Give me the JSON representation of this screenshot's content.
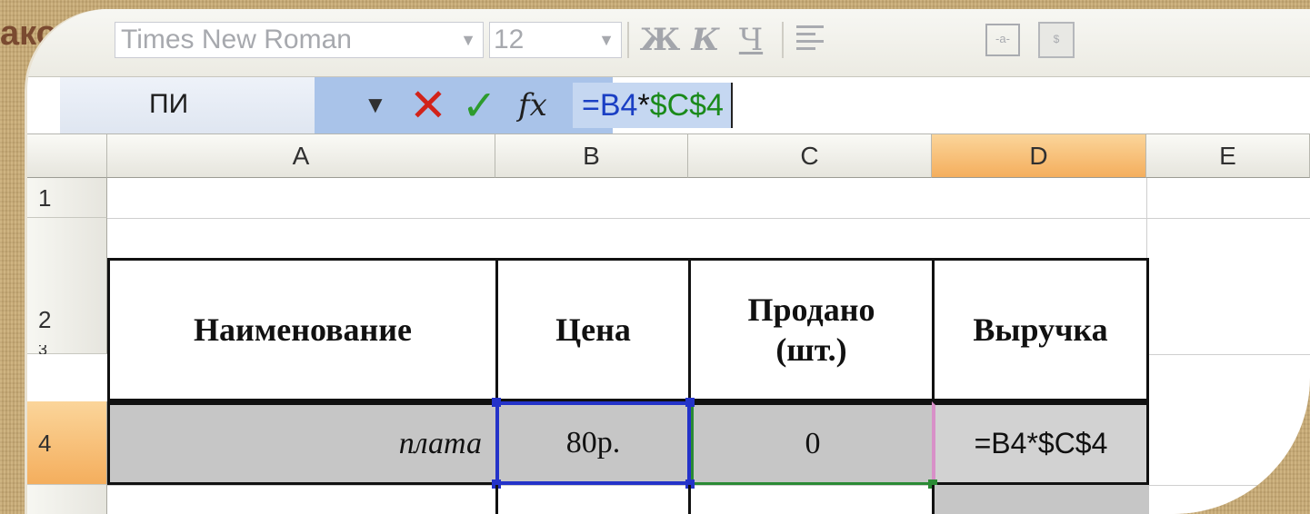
{
  "slide_title": "аков ф",
  "toolbar": {
    "font_name": "Times New Roman",
    "font_size": "12",
    "bold_label": "Ж",
    "italic_label": "К",
    "underline_label": "Ч",
    "merge_label": "-a-",
    "money_label": "$"
  },
  "formula_bar": {
    "name_box": "ПИ",
    "cancel_label": "✕",
    "enter_label": "✓",
    "fx_label": "fx",
    "formula_eq": "=",
    "formula_ref": "B4",
    "formula_op": "*",
    "formula_abs": "$C$4"
  },
  "columns": [
    "A",
    "B",
    "C",
    "D",
    "E"
  ],
  "rows": [
    "1",
    "2",
    "3",
    "4"
  ],
  "table": {
    "headers": {
      "name": "Наименование",
      "price": "Цена",
      "sold_line1": "Продано",
      "sold_line2": "(шт.)",
      "revenue": "Выручка"
    },
    "row4": {
      "name": "плата",
      "price": "80р.",
      "sold": "0",
      "revenue": "=B4*$C$4"
    }
  },
  "colors": {
    "selected_header": "#f4ae5d",
    "cancel": "#d2231a",
    "enter": "#2d9b2d",
    "ref_blue": "#1a3fc4",
    "ref_green": "#1a8a1a"
  }
}
